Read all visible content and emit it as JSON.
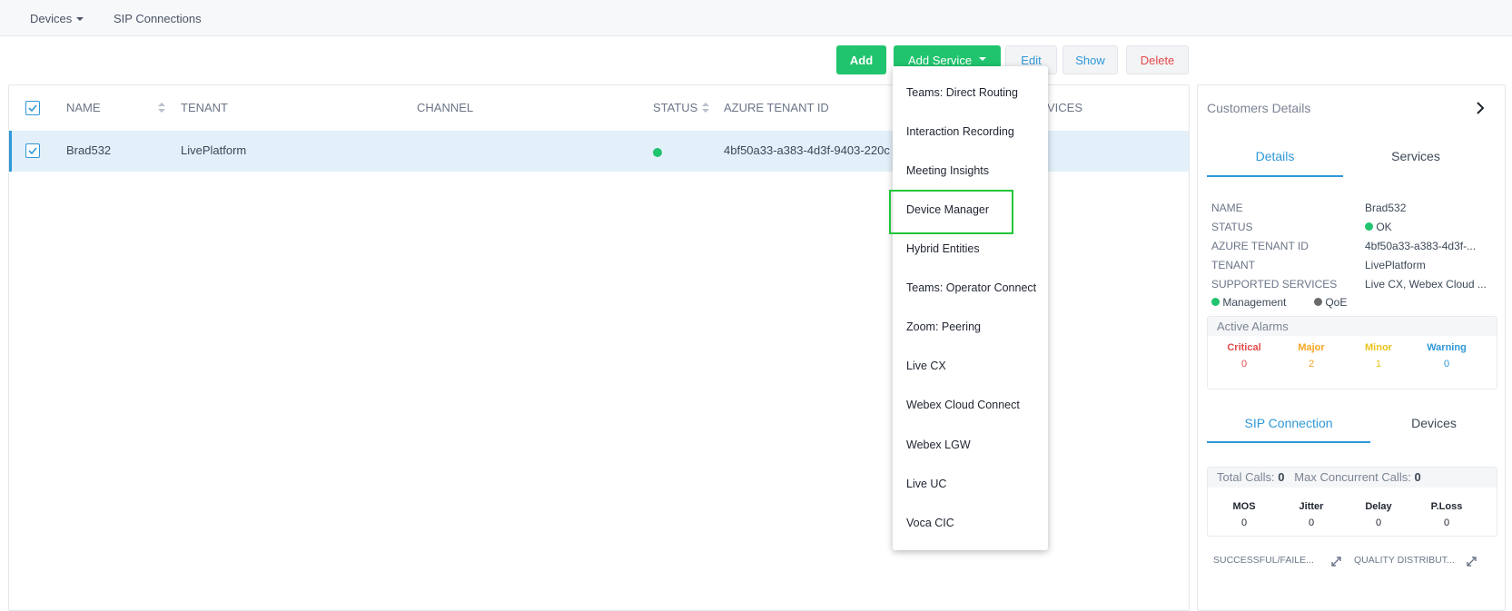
{
  "topnav": {
    "devices": "Devices",
    "sip": "SIP Connections"
  },
  "toolbar": {
    "add": "Add",
    "add_service": "Add Service",
    "edit": "Edit",
    "show": "Show",
    "delete": "Delete"
  },
  "table": {
    "headers": {
      "name": "NAME",
      "tenant": "TENANT",
      "channel": "CHANNEL",
      "status": "STATUS",
      "azure": "AZURE TENANT ID",
      "services": "VICES"
    },
    "rows": [
      {
        "name": "Brad532",
        "tenant": "LivePlatform",
        "channel": "",
        "status_color": "#20c46e",
        "azure": "4bf50a33-a383-4d3f-9403-220c"
      }
    ]
  },
  "dropdown": {
    "items": [
      "Teams: Direct Routing",
      "Interaction Recording",
      "Meeting Insights",
      "Device Manager",
      "Hybrid Entities",
      "Teams: Operator Connect",
      "Zoom: Peering",
      "Live CX",
      "Webex Cloud Connect",
      "Webex LGW",
      "Live UC",
      "Voca CIC"
    ],
    "highlighted": "Device Manager"
  },
  "side": {
    "title": "Customers Details",
    "tabs": {
      "details": "Details",
      "services": "Services"
    },
    "details": {
      "name_k": "NAME",
      "name_v": "Brad532",
      "status_k": "STATUS",
      "status_v": "OK",
      "azure_k": "AZURE TENANT ID",
      "azure_v": "4bf50a33-a383-4d3f-...",
      "tenant_k": "TENANT",
      "tenant_v": "LivePlatform",
      "supported_k": "SUPPORTED SERVICES",
      "supported_v": "Live CX, Webex Cloud ...",
      "management": "Management",
      "qoe": "QoE"
    },
    "alarms": {
      "title": "Active Alarms",
      "critical": {
        "label": "Critical",
        "value": "0",
        "color": "#e24a4a"
      },
      "major": {
        "label": "Major",
        "value": "2",
        "color": "#f5a623"
      },
      "minor": {
        "label": "Minor",
        "value": "1",
        "color": "#e8c21b"
      },
      "warning": {
        "label": "Warning",
        "value": "0",
        "color": "#2f98d8"
      }
    },
    "tabs2": {
      "sip": "SIP Connection",
      "devices": "Devices"
    },
    "calls": {
      "total_label": "Total Calls:",
      "total_value": "0",
      "max_label": "Max Concurrent Calls:",
      "max_value": "0",
      "mos": {
        "label": "MOS",
        "value": "0"
      },
      "jitter": {
        "label": "Jitter",
        "value": "0"
      },
      "delay": {
        "label": "Delay",
        "value": "0"
      },
      "ploss": {
        "label": "P.Loss",
        "value": "0"
      }
    },
    "footer": {
      "left": "SUCCESSFUL/FAILE...",
      "right": "QUALITY DISTRIBUT..."
    }
  }
}
